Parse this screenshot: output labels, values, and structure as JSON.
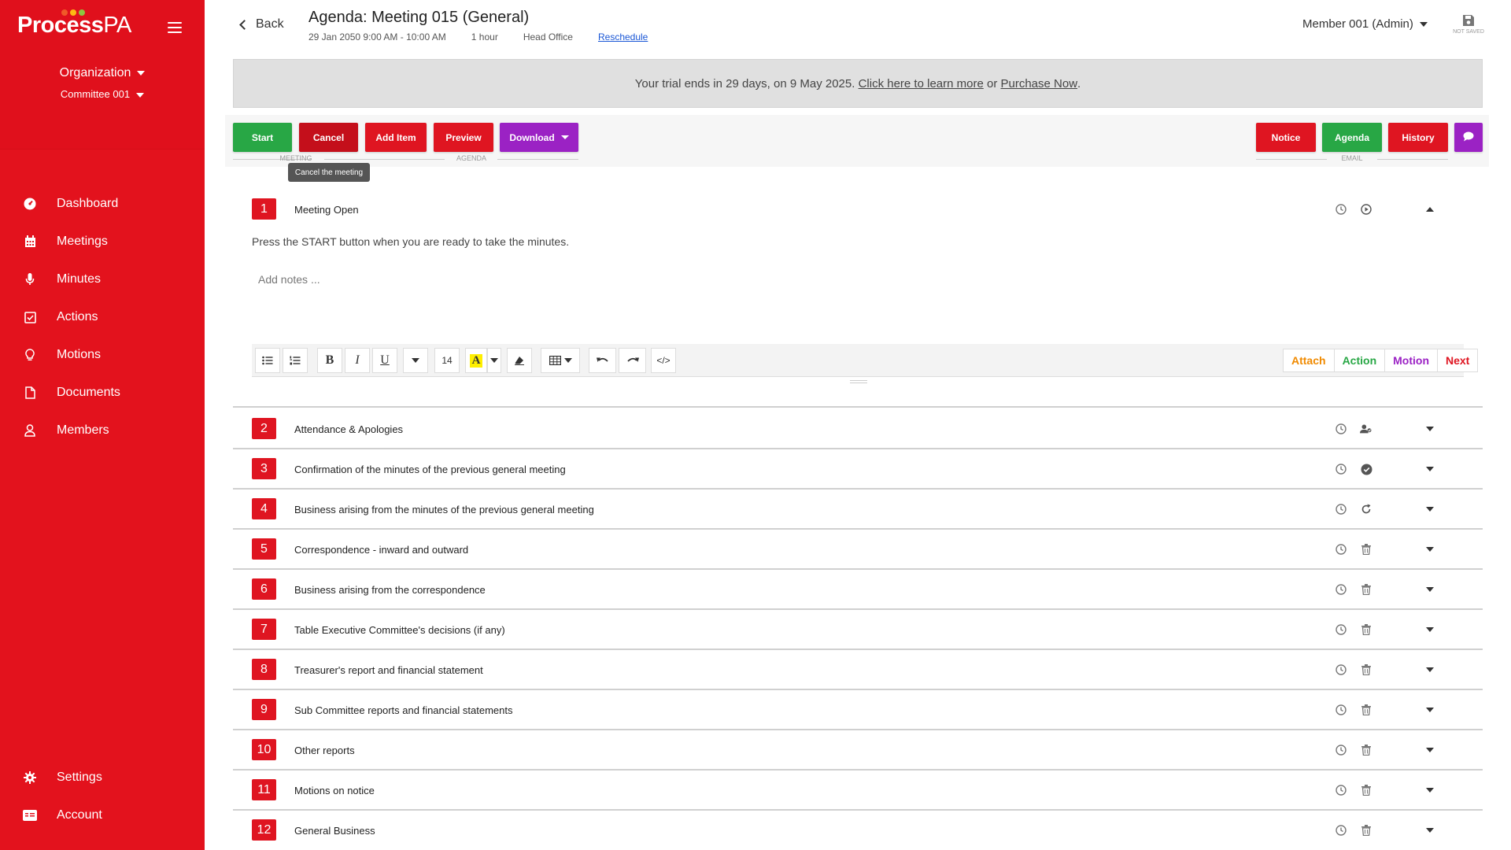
{
  "app": {
    "logo_text": "Process",
    "logo_suffix": "PA",
    "organization": "Organization",
    "committee": "Committee 001"
  },
  "colors": {
    "brand_red": "#e3121d",
    "start_green": "#28a745",
    "action_purple": "#9b22c4",
    "attach_orange": "#f08a00",
    "action_green": "#28a745",
    "motion_purple": "#9b22c4",
    "next_red": "#df1521"
  },
  "nav": {
    "items": [
      {
        "label": "Dashboard",
        "icon": "dashboard-icon"
      },
      {
        "label": "Meetings",
        "icon": "calendar-icon"
      },
      {
        "label": "Minutes",
        "icon": "microphone-icon"
      },
      {
        "label": "Actions",
        "icon": "checkbox-icon"
      },
      {
        "label": "Motions",
        "icon": "lightbulb-icon"
      },
      {
        "label": "Documents",
        "icon": "document-icon"
      },
      {
        "label": "Members",
        "icon": "person-icon"
      }
    ],
    "bottom": [
      {
        "label": "Settings",
        "icon": "gear-icon"
      },
      {
        "label": "Account",
        "icon": "id-card-icon"
      }
    ]
  },
  "header": {
    "back_label": "Back",
    "title": "Agenda: Meeting 015 (General)",
    "date_time": "29 Jan 2050 9:00 AM - 10:00 AM",
    "duration": "1 hour",
    "location": "Head Office",
    "reschedule_label": "Reschedule",
    "user_label": "Member 001 (Admin)",
    "save_status": "NOT SAVED"
  },
  "trial": {
    "text": "Your trial ends in 29 days, on 9 May 2025.",
    "learn_more": "Click here to learn more",
    "or_text": "or",
    "purchase": "Purchase Now",
    "period": "."
  },
  "toolbar": {
    "start": "Start",
    "cancel": "Cancel",
    "add_item": "Add Item",
    "preview": "Preview",
    "download": "Download",
    "notice": "Notice",
    "agenda": "Agenda",
    "history": "History",
    "meeting_group": "MEETING",
    "agenda_group": "AGENDA",
    "email_group": "EMAIL",
    "cancel_tooltip": "Cancel the meeting"
  },
  "open_item": {
    "number": "1",
    "title": "Meeting Open",
    "description": "Press the START button when you are ready to take the minutes.",
    "notes_placeholder": "Add notes ...",
    "font_size": "14",
    "actions": {
      "attach": "Attach",
      "action": "Action",
      "motion": "Motion",
      "next": "Next"
    }
  },
  "items": [
    {
      "number": "2",
      "title": "Attendance & Apologies",
      "status_icon": "attendance-icon"
    },
    {
      "number": "3",
      "title": "Confirmation of the minutes of the previous general meeting",
      "status_icon": "check-circle-icon"
    },
    {
      "number": "4",
      "title": "Business arising from the minutes of the previous general meeting",
      "status_icon": "refresh-icon"
    },
    {
      "number": "5",
      "title": "Correspondence - inward and outward",
      "status_icon": "trash-icon"
    },
    {
      "number": "6",
      "title": "Business arising from the correspondence",
      "status_icon": "trash-icon"
    },
    {
      "number": "7",
      "title": "Table Executive Committee's decisions (if any)",
      "status_icon": "trash-icon"
    },
    {
      "number": "8",
      "title": "Treasurer's report and financial statement",
      "status_icon": "trash-icon"
    },
    {
      "number": "9",
      "title": "Sub Committee reports and financial statements",
      "status_icon": "trash-icon"
    },
    {
      "number": "10",
      "title": "Other reports",
      "status_icon": "trash-icon"
    },
    {
      "number": "11",
      "title": "Motions on notice",
      "status_icon": "trash-icon"
    },
    {
      "number": "12",
      "title": "General Business",
      "status_icon": "trash-icon"
    }
  ]
}
